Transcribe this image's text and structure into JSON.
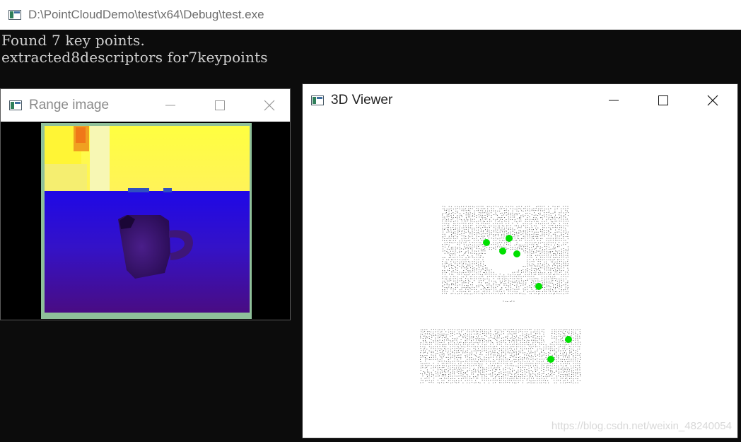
{
  "console": {
    "title": "D:\\PointCloudDemo\\test\\x64\\Debug\\test.exe",
    "lines": [
      "Found 7 key points.",
      "extracted8descriptors for7keypoints"
    ]
  },
  "range_window": {
    "title": "Range image"
  },
  "viewer_window": {
    "title": "3D Viewer",
    "keypoint_color": "#00e000"
  },
  "watermark": "https://blog.csdn.net/weixin_48240054",
  "colors": {
    "console_bg": "#0c0c0c",
    "console_text": "#d0d0d0",
    "range_far": "#ffff33",
    "range_near": "#1a0ad8",
    "range_deep": "#3a0a7a",
    "range_border": "#8fc09a"
  }
}
